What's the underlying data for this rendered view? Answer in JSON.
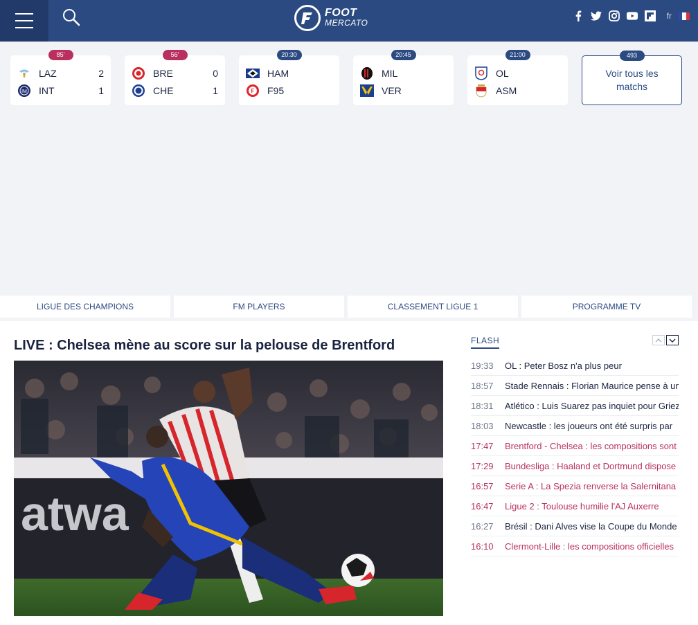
{
  "header": {
    "logo_line1": "FOOT",
    "logo_line2": "MERCATO",
    "language": "fr",
    "social_icons": [
      "facebook-icon",
      "twitter-icon",
      "instagram-icon",
      "youtube-icon",
      "flipboard-icon"
    ],
    "brand_color": "#2c4a82"
  },
  "matches": [
    {
      "badge": "85'",
      "status": "live",
      "home": "LAZ",
      "away": "INT",
      "home_score": "2",
      "away_score": "1"
    },
    {
      "badge": "56'",
      "status": "live",
      "home": "BRE",
      "away": "CHE",
      "home_score": "0",
      "away_score": "1"
    },
    {
      "badge": "20:30",
      "status": "scheduled",
      "home": "HAM",
      "away": "F95",
      "home_score": "",
      "away_score": ""
    },
    {
      "badge": "20:45",
      "status": "scheduled",
      "home": "MIL",
      "away": "VER",
      "home_score": "",
      "away_score": ""
    },
    {
      "badge": "21:00",
      "status": "scheduled",
      "home": "OL",
      "away": "ASM",
      "home_score": "",
      "away_score": ""
    }
  ],
  "all_matches": {
    "count": "493",
    "label": "Voir tous les matchs"
  },
  "nav": [
    "LIGUE DES CHAMPIONS",
    "FM PLAYERS",
    "CLASSEMENT LIGUE 1",
    "PROGRAMME TV"
  ],
  "article": {
    "headline": "LIVE : Chelsea mène au score sur la pelouse de Brentford"
  },
  "flash": {
    "title": "FLASH",
    "items": [
      {
        "time": "19:33",
        "text": "OL : Peter Bosz n'a plus peur",
        "hot": false
      },
      {
        "time": "18:57",
        "text": "Stade Rennais : Florian Maurice pense à un",
        "hot": false
      },
      {
        "time": "18:31",
        "text": "Atlético : Luis Suarez pas inquiet pour Griez",
        "hot": false
      },
      {
        "time": "18:03",
        "text": "Newcastle : les joueurs ont été surpris par",
        "hot": false
      },
      {
        "time": "17:47",
        "text": "Brentford - Chelsea : les compositions sont",
        "hot": true
      },
      {
        "time": "17:29",
        "text": "Bundesliga : Haaland et Dortmund dispose",
        "hot": true
      },
      {
        "time": "16:57",
        "text": "Serie A : La Spezia renverse la Salernitana",
        "hot": true
      },
      {
        "time": "16:47",
        "text": "Ligue 2 : Toulouse humilie l'AJ Auxerre",
        "hot": true
      },
      {
        "time": "16:27",
        "text": "Brésil : Dani Alves vise la Coupe du Monde",
        "hot": false
      },
      {
        "time": "16:10",
        "text": "Clermont-Lille : les compositions officielles",
        "hot": true
      }
    ]
  },
  "colors": {
    "live": "#b9305f",
    "scheduled": "#2c4a82"
  }
}
